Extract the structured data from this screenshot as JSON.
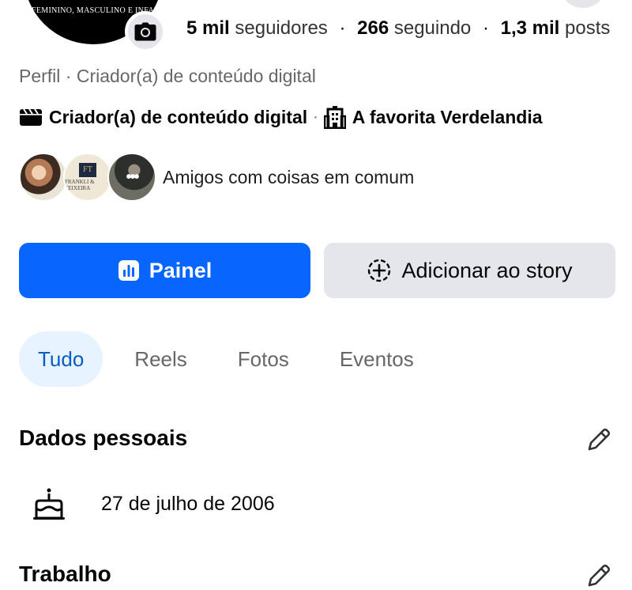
{
  "profile": {
    "avatar_text": "FEMININO, MASCULINO E INFANTIL"
  },
  "stats": {
    "followers_num": "5 mil",
    "followers_label": "seguidores",
    "following_num": "266",
    "following_label": "seguindo",
    "posts_num": "1,3 mil",
    "posts_label": "posts",
    "separator": "·"
  },
  "subtitle": "Perfil · Criador(a) de conteúdo digital",
  "category": {
    "label": "Criador(a) de conteúdo digital",
    "separator": "·",
    "favorite": "A favorita Verdelandia"
  },
  "friends": {
    "label": "Amigos com coisas em comum",
    "items": [
      {
        "kind": "photo"
      },
      {
        "kind": "logo",
        "monogram": "FT",
        "name": "FRANKLI & TEIXEIRA"
      },
      {
        "kind": "more",
        "glyph": "•••"
      }
    ]
  },
  "actions": {
    "primary": "Painel",
    "secondary": "Adicionar ao story"
  },
  "tabs": [
    {
      "label": "Tudo",
      "active": true
    },
    {
      "label": "Reels",
      "active": false
    },
    {
      "label": "Fotos",
      "active": false
    },
    {
      "label": "Eventos",
      "active": false
    }
  ],
  "personal": {
    "title": "Dados pessoais",
    "birthday": "27 de julho de 2006"
  },
  "work": {
    "title": "Trabalho"
  },
  "colors": {
    "primary": "#0866ff",
    "secondary_bg": "#e4e6eb",
    "tab_active_bg": "#e7f3ff",
    "tab_active_text": "#0a5dc2",
    "muted": "#65676b"
  },
  "icons": [
    "camera-icon",
    "clapperboard-icon",
    "building-icon",
    "chart-icon",
    "add-story-icon",
    "pencil-icon",
    "cake-icon"
  ]
}
